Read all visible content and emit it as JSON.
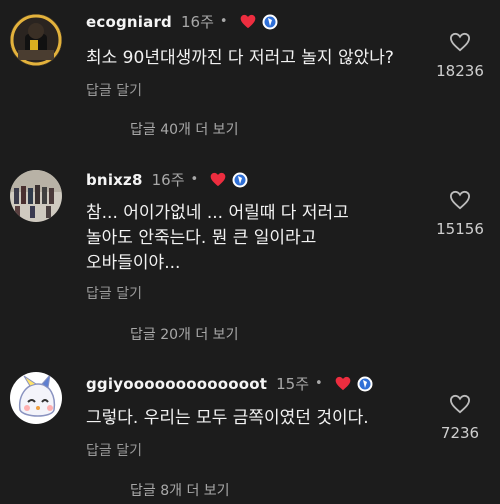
{
  "comments": [
    {
      "username": "ecogniard",
      "time": "16주",
      "text": "최소 90년대생까진 다 저러고 놀지 않았나?",
      "reply_label": "답글 달기",
      "view_replies": "답글 40개 더 보기",
      "likes": "18236"
    },
    {
      "username": "bnixz8",
      "time": "16주",
      "text": "참... 어이가없네 ... 어릴때 다 저러고\n놀아도 안죽는다. 뭔 큰 일이라고\n오바들이야...",
      "reply_label": "답글 달기",
      "view_replies": "답글 20개 더 보기",
      "likes": "15156"
    },
    {
      "username": "ggiyooooooooooooot",
      "time": "15주",
      "text": "그렇다. 우리는 모두 금쪽이였던 것이다.",
      "reply_label": "답글 달기",
      "view_replies": "답글 8개 더 보기",
      "likes": "7236"
    }
  ],
  "separator": "•",
  "icons": {
    "creator_heart": "heart-filled-icon",
    "verified_badge": "creator-avatar-badge-icon",
    "like": "heart-outline-icon"
  },
  "colors": {
    "background": "#1c1c1c",
    "heart_red": "#ed2d3f",
    "badge_blue": "#2f6fd6"
  }
}
